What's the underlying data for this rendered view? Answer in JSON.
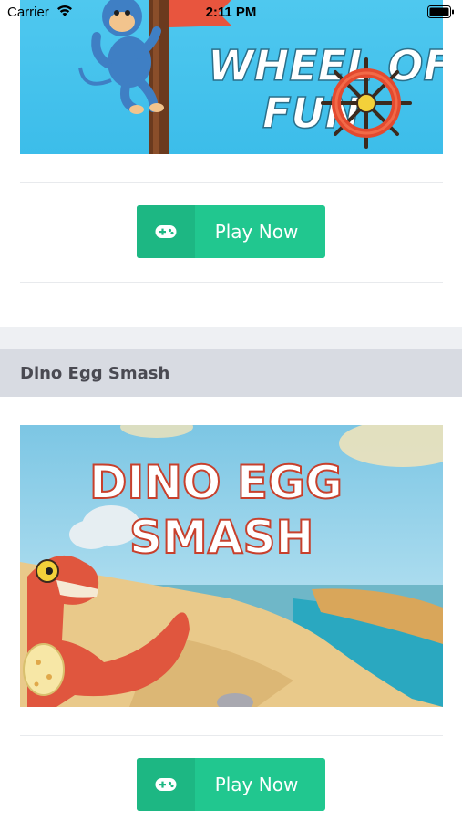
{
  "status_bar": {
    "carrier": "Carrier",
    "time": "2:11 PM",
    "icons": [
      "wifi-icon",
      "battery-icon"
    ]
  },
  "games": [
    {
      "banner_text_line1": "WHEEL OF",
      "banner_text_line2": "FUN",
      "play_label": "Play Now",
      "play_icon": "gamepad-icon"
    },
    {
      "title": "Dino Egg Smash",
      "banner_text_line1": "DINO EGG",
      "banner_text_line2": "SMASH",
      "play_label": "Play Now",
      "play_icon": "gamepad-icon"
    }
  ],
  "colors": {
    "button": "#21c78f",
    "button_icon_box": "#1db783",
    "section_header_bg": "#d8dbe2",
    "section_title": "#4a4a52"
  }
}
